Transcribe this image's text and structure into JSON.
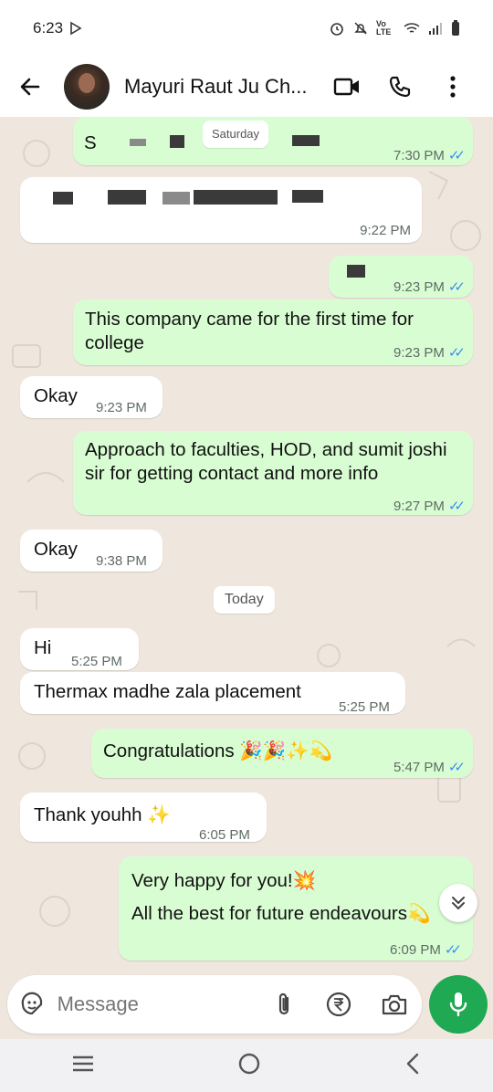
{
  "status_bar": {
    "time": "6:23",
    "network_label": "Vo LTE"
  },
  "header": {
    "contact_name": "Mayuri Raut Ju Ch..."
  },
  "messages": [
    {
      "dir": "out",
      "text": "S",
      "time": "7:30 PM",
      "status": "read"
    },
    {
      "dir": "in",
      "text": "",
      "time": "9:22 PM"
    },
    {
      "dir": "out",
      "text": "",
      "time": "9:23 PM",
      "status": "read"
    },
    {
      "dir": "out",
      "text": "This company came for the first time for college",
      "time": "9:23 PM",
      "status": "read"
    },
    {
      "dir": "in",
      "text": "Okay",
      "time": "9:23 PM"
    },
    {
      "dir": "out",
      "text": "Approach to faculties, HOD, and sumit joshi sir for getting contact and more info",
      "time": "9:27 PM",
      "status": "read"
    },
    {
      "dir": "in",
      "text": "Okay",
      "time": "9:38 PM"
    },
    {
      "dir": "date",
      "text": "Today"
    },
    {
      "dir": "in",
      "text": "Hi",
      "time": "5:25 PM"
    },
    {
      "dir": "in",
      "text": "Thermax madhe zala placement",
      "time": "5:25 PM"
    },
    {
      "dir": "out",
      "text": "Congratulations 🎉🎉✨💫",
      "time": "5:47 PM",
      "status": "read"
    },
    {
      "dir": "in",
      "text": "Thank youhh ✨",
      "time": "6:05 PM"
    },
    {
      "dir": "out",
      "text_line1": "Very happy for you!💥",
      "text_line2": "All the best for future endeavours💫",
      "time": "6:09 PM",
      "status": "read"
    }
  ],
  "date_pill_top": "Saturday",
  "input": {
    "placeholder": "Message"
  },
  "icons": {
    "back": "arrow-left-icon",
    "video": "video-call-icon",
    "call": "phone-icon",
    "menu": "more-vert-icon",
    "sticker": "sticker-icon",
    "attach": "paperclip-icon",
    "payment": "rupee-icon",
    "camera": "camera-icon",
    "mic": "microphone-icon",
    "scroll": "chevron-double-down-icon"
  },
  "colors": {
    "outgoing_bubble": "#d9fdd3",
    "incoming_bubble": "#ffffff",
    "read_ticks": "#3b8ef2",
    "mic_button": "#1ea952"
  }
}
